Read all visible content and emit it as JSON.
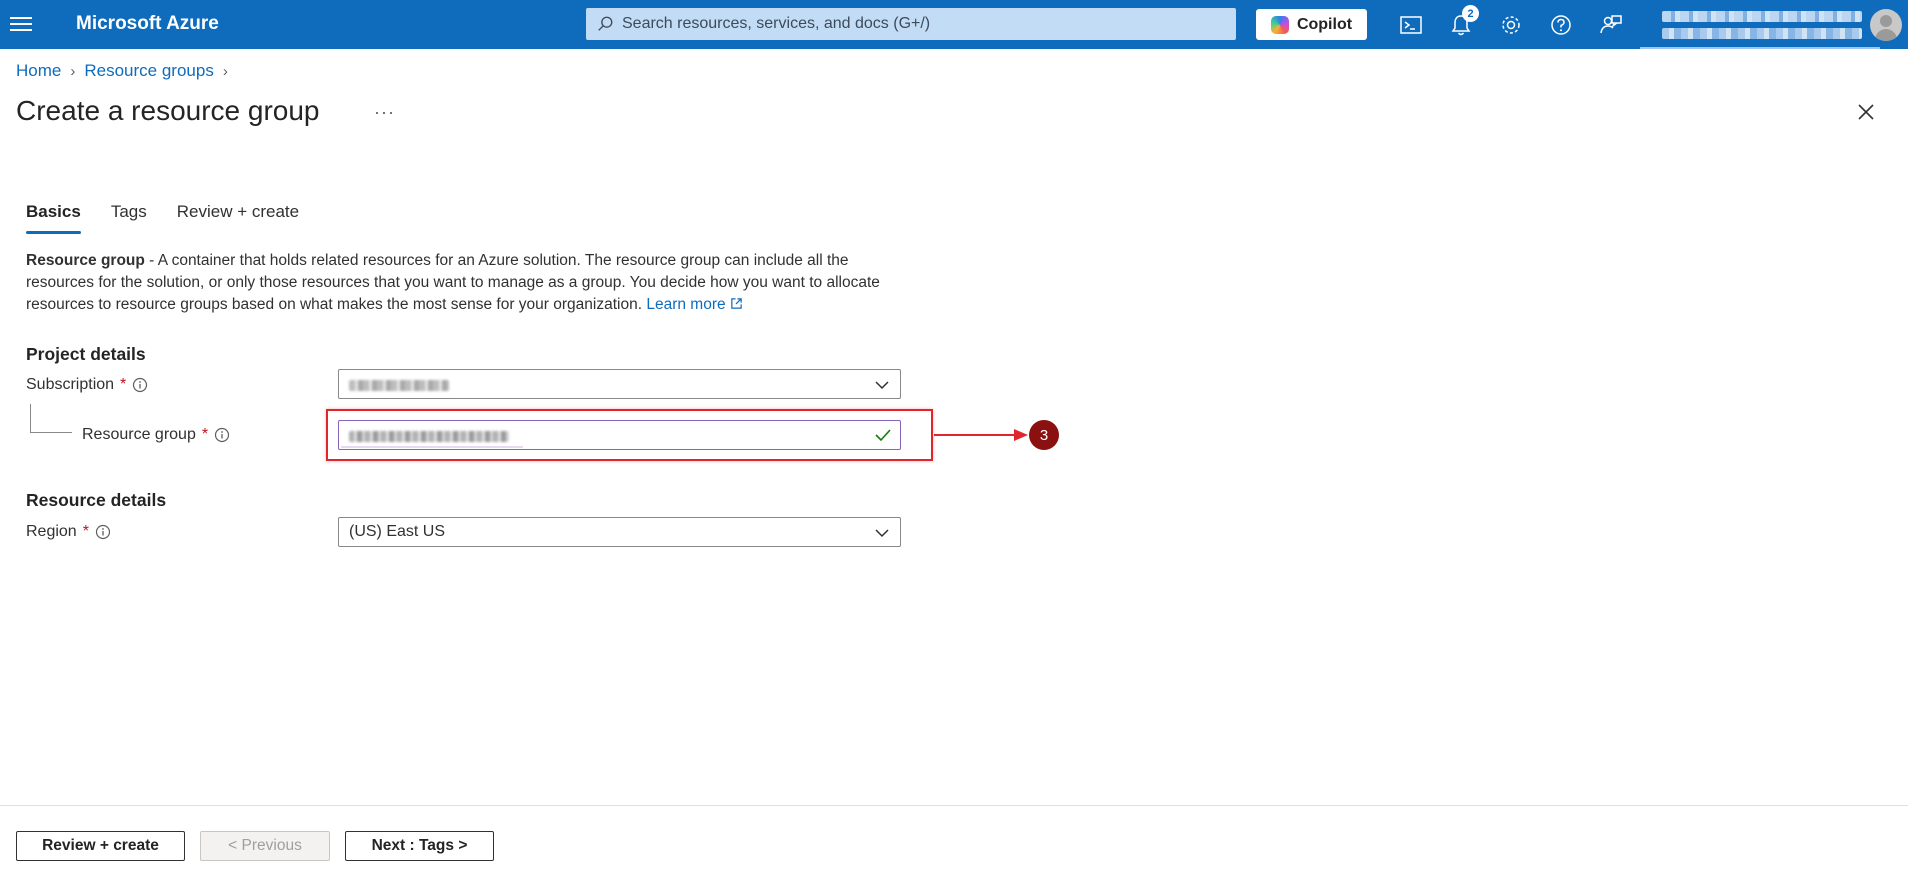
{
  "topbar": {
    "brand": "Microsoft Azure",
    "search_placeholder": "Search resources, services, and docs (G+/)",
    "copilot_label": "Copilot",
    "notification_count": "2",
    "colors": {
      "bar": "#0f6cbd"
    }
  },
  "breadcrumb": [
    "Home",
    "Resource groups"
  ],
  "page": {
    "title": "Create a resource group",
    "more_label": "···"
  },
  "tabs": [
    {
      "label": "Basics",
      "active": true
    },
    {
      "label": "Tags",
      "active": false
    },
    {
      "label": "Review + create",
      "active": false
    }
  ],
  "description": {
    "bold": "Resource group",
    "text": " - A container that holds related resources for an Azure solution. The resource group can include all the resources for the solution, or only those resources that you want to manage as a group. You decide how you want to allocate resources to resource groups based on what makes the most sense for your organization.",
    "link": "Learn more"
  },
  "project_details": {
    "heading": "Project details",
    "subscription_label": "Subscription",
    "resource_group_label": "Resource group"
  },
  "resource_details": {
    "heading": "Resource details",
    "region_label": "Region",
    "region_value": "(US) East US"
  },
  "annotation": {
    "step": "3",
    "color": "#e0262a"
  },
  "footer": {
    "review_create": "Review + create",
    "previous": "< Previous",
    "next": "Next : Tags >"
  }
}
